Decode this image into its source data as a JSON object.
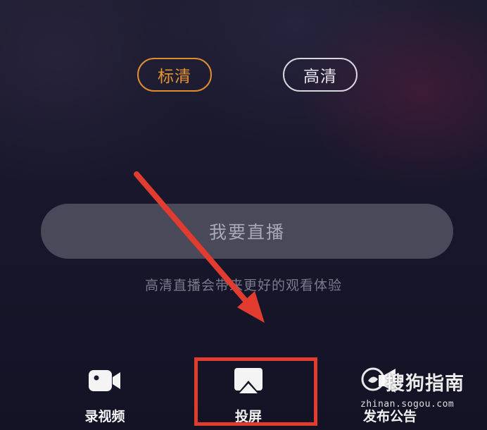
{
  "quality": {
    "standard_label": "标清",
    "high_label": "高清",
    "selected": "standard"
  },
  "live": {
    "button_label": "我要直播",
    "hint": "高清直播会带来更好的观看体验"
  },
  "toolbar": {
    "record_label": "录视频",
    "cast_label": "投屏",
    "notice_label": "发布公告"
  },
  "icons": {
    "record": "video-camera-icon",
    "cast": "screen-cast-icon",
    "notice": "announcement-icon"
  },
  "colors": {
    "accent_orange": "#e08d2f",
    "annotation_red": "#e23b2f",
    "button_fill": "#4a4959",
    "background": "#17162a"
  },
  "watermark": {
    "brand": "搜狗指南",
    "url": "zhinan.sogou.com"
  }
}
